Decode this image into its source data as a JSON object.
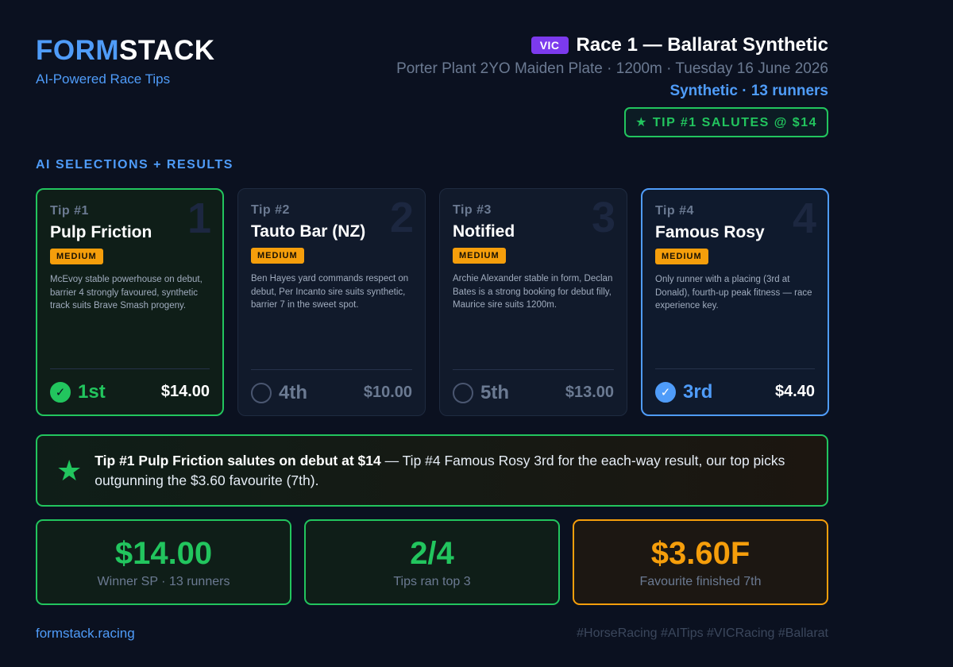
{
  "brand": {
    "logo_part1": "FORM",
    "logo_part2": "STACK",
    "tagline": "AI-Powered Race Tips",
    "primary_color": "#4f9cf9"
  },
  "race": {
    "state": "VIC",
    "title": "Race 1 — Ballarat Synthetic",
    "subtitle": "Porter Plant 2YO Maiden Plate · 1200m · Tuesday 16 June 2026",
    "meta": "Synthetic · 13 runners",
    "salute_badge": "★ TIP #1 SALUTES @ $14"
  },
  "section_label": "AI SELECTIONS + RESULTS",
  "tips": [
    {
      "number": "1",
      "label": "Tip #1",
      "horse": "Pulp Friction",
      "confidence": "MEDIUM",
      "description": "McEvoy stable powerhouse on debut, barrier 4 strongly favoured, synthetic track suits Brave Smash progeny.",
      "result": "1st",
      "price": "$14.00",
      "status": "win",
      "icon": "check-icon"
    },
    {
      "number": "2",
      "label": "Tip #2",
      "horse": "Tauto Bar (NZ)",
      "confidence": "MEDIUM",
      "description": "Ben Hayes yard commands respect on debut, Per Incanto sire suits synthetic, barrier 7 in the sweet spot.",
      "result": "4th",
      "price": "$10.00",
      "status": "lose",
      "icon": "empty-circle-icon"
    },
    {
      "number": "3",
      "label": "Tip #3",
      "horse": "Notified",
      "confidence": "MEDIUM",
      "description": "Archie Alexander stable in form, Declan Bates is a strong booking for debut filly, Maurice sire suits 1200m.",
      "result": "5th",
      "price": "$13.00",
      "status": "lose",
      "icon": "empty-circle-icon"
    },
    {
      "number": "4",
      "label": "Tip #4",
      "horse": "Famous Rosy",
      "confidence": "MEDIUM",
      "description": "Only runner with a placing (3rd at Donald), fourth-up peak fitness — race experience key.",
      "result": "3rd",
      "price": "$4.40",
      "status": "place",
      "icon": "check-icon"
    }
  ],
  "summary": {
    "bold": "Tip #1 Pulp Friction salutes on debut at $14",
    "rest": " — Tip #4 Famous Rosy 3rd for the each-way result, our top picks outgunning the $3.60 favourite (7th)."
  },
  "stats": [
    {
      "value": "$14.00",
      "label": "Winner SP · 13 runners",
      "tone": "green"
    },
    {
      "value": "2/4",
      "label": "Tips ran top 3",
      "tone": "green"
    },
    {
      "value": "$3.60F",
      "label": "Favourite finished 7th",
      "tone": "amber"
    }
  ],
  "footer": {
    "url": "formstack.racing",
    "tags": "#HorseRacing #AITips #VICRacing #Ballarat"
  },
  "colors": {
    "win": "#22c55e",
    "place": "#4f9cf9",
    "amber": "#f59e0b",
    "state_badge": "#7c3aed",
    "background": "#0b1120"
  }
}
